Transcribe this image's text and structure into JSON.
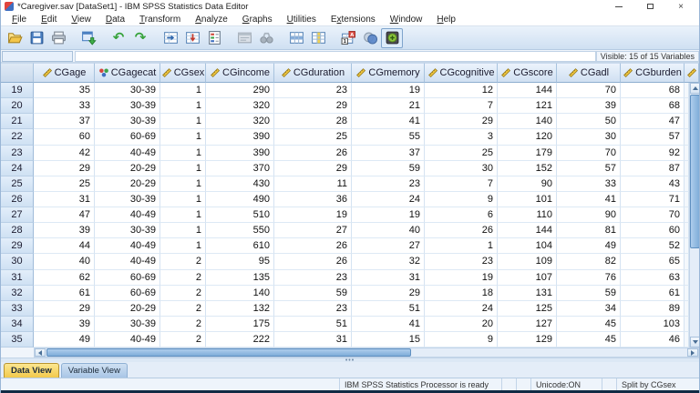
{
  "window": {
    "title": "*Caregiver.sav [DataSet1] - IBM SPSS Statistics Data Editor",
    "window_controls": [
      "minimize-icon",
      "restore-icon",
      "close-icon"
    ]
  },
  "menu": {
    "items": [
      {
        "label": "File",
        "u": 0
      },
      {
        "label": "Edit",
        "u": 0
      },
      {
        "label": "View",
        "u": 0
      },
      {
        "label": "Data",
        "u": 0
      },
      {
        "label": "Transform",
        "u": 0
      },
      {
        "label": "Analyze",
        "u": 0
      },
      {
        "label": "Graphs",
        "u": 0
      },
      {
        "label": "Utilities",
        "u": 0
      },
      {
        "label": "Extensions",
        "u": 1
      },
      {
        "label": "Window",
        "u": 0
      },
      {
        "label": "Help",
        "u": 0
      }
    ]
  },
  "toolbar": {
    "groups": [
      [
        "open-file",
        "save-file",
        "print"
      ],
      [
        "recall-dialogs"
      ],
      [
        "undo",
        "redo"
      ],
      [
        "goto-case",
        "goto-variable",
        "variables"
      ],
      [
        "find-dialog",
        "find"
      ],
      [
        "insert-cases",
        "insert-variable"
      ],
      [
        "value-labels",
        "use-variable-sets",
        "show-all-variables"
      ]
    ],
    "disabled": [
      "find-dialog",
      "find"
    ],
    "selected": [
      "show-all-variables"
    ]
  },
  "edit_bar": {
    "cell_reference": "",
    "cell_editor": "",
    "visible_label": "Visible: 15 of 15 Variables"
  },
  "table": {
    "columns": [
      {
        "label": "CGage",
        "measure": "scale"
      },
      {
        "label": "CGagecat",
        "measure": "nominal"
      },
      {
        "label": "CGsex",
        "measure": "scale"
      },
      {
        "label": "CGincome",
        "measure": "scale"
      },
      {
        "label": "CGduration",
        "measure": "scale"
      },
      {
        "label": "CGmemory",
        "measure": "scale"
      },
      {
        "label": "CGcognitive",
        "measure": "scale"
      },
      {
        "label": "CGscore",
        "measure": "scale"
      },
      {
        "label": "CGadl",
        "measure": "scale"
      },
      {
        "label": "CGburden",
        "measure": "scale"
      }
    ],
    "rows": [
      {
        "n": "19",
        "values": [
          "35",
          "30-39",
          "1",
          "290",
          "23",
          "19",
          "12",
          "144",
          "70",
          "68"
        ]
      },
      {
        "n": "20",
        "values": [
          "33",
          "30-39",
          "1",
          "320",
          "29",
          "21",
          "7",
          "121",
          "39",
          "68"
        ]
      },
      {
        "n": "21",
        "values": [
          "37",
          "30-39",
          "1",
          "320",
          "28",
          "41",
          "29",
          "140",
          "50",
          "47"
        ]
      },
      {
        "n": "22",
        "values": [
          "60",
          "60-69",
          "1",
          "390",
          "25",
          "55",
          "3",
          "120",
          "30",
          "57"
        ]
      },
      {
        "n": "23",
        "values": [
          "42",
          "40-49",
          "1",
          "390",
          "26",
          "37",
          "25",
          "179",
          "70",
          "92"
        ]
      },
      {
        "n": "24",
        "values": [
          "29",
          "20-29",
          "1",
          "370",
          "29",
          "59",
          "30",
          "152",
          "57",
          "87"
        ]
      },
      {
        "n": "25",
        "values": [
          "25",
          "20-29",
          "1",
          "430",
          "11",
          "23",
          "7",
          "90",
          "33",
          "43"
        ]
      },
      {
        "n": "26",
        "values": [
          "31",
          "30-39",
          "1",
          "490",
          "36",
          "24",
          "9",
          "101",
          "41",
          "71"
        ]
      },
      {
        "n": "27",
        "values": [
          "47",
          "40-49",
          "1",
          "510",
          "19",
          "19",
          "6",
          "110",
          "90",
          "70"
        ]
      },
      {
        "n": "28",
        "values": [
          "39",
          "30-39",
          "1",
          "550",
          "27",
          "40",
          "26",
          "144",
          "81",
          "60"
        ]
      },
      {
        "n": "29",
        "values": [
          "44",
          "40-49",
          "1",
          "610",
          "26",
          "27",
          "1",
          "104",
          "49",
          "52"
        ]
      },
      {
        "n": "30",
        "values": [
          "40",
          "40-49",
          "2",
          "95",
          "26",
          "32",
          "23",
          "109",
          "82",
          "65"
        ]
      },
      {
        "n": "31",
        "values": [
          "62",
          "60-69",
          "2",
          "135",
          "23",
          "31",
          "19",
          "107",
          "76",
          "63"
        ]
      },
      {
        "n": "32",
        "values": [
          "61",
          "60-69",
          "2",
          "140",
          "59",
          "29",
          "18",
          "131",
          "59",
          "61"
        ]
      },
      {
        "n": "33",
        "values": [
          "29",
          "20-29",
          "2",
          "132",
          "23",
          "51",
          "24",
          "125",
          "34",
          "89"
        ]
      },
      {
        "n": "34",
        "values": [
          "39",
          "30-39",
          "2",
          "175",
          "51",
          "41",
          "20",
          "127",
          "45",
          "103"
        ]
      },
      {
        "n": "35",
        "values": [
          "49",
          "40-49",
          "2",
          "222",
          "31",
          "15",
          "9",
          "129",
          "45",
          "46"
        ]
      }
    ]
  },
  "tabs": {
    "data_view": "Data View",
    "variable_view": "Variable View",
    "active_tab": "Data View"
  },
  "status": {
    "processor": "IBM SPSS Statistics Processor is ready",
    "unicode": "Unicode:ON",
    "split": "Split by CGsex"
  },
  "colors": {
    "accent_blue": "#4a7fc1",
    "header_fill": "#d0e0f2",
    "active_tab": "#f2c94c",
    "scale_icon_yellow": "#f0c63f",
    "nominal_red": "#d8453e",
    "nominal_green": "#3fa44a",
    "nominal_blue": "#3f6fc1"
  }
}
